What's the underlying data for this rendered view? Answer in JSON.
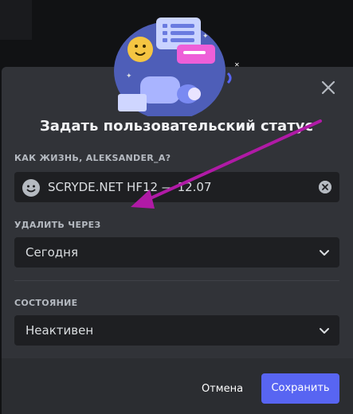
{
  "dialog": {
    "title": "Задать пользовательский статус",
    "status_label": "КАК ЖИЗНЬ, ALEKSANDER_A?",
    "status_value": "SCRYDE.NET HF12 — 12.07",
    "clear_after_label": "УДАЛИТЬ ЧЕРЕЗ",
    "clear_after_value": "Сегодня",
    "state_label": "СОСТОЯНИЕ",
    "state_value": "Неактивен",
    "cancel_label": "Отмена",
    "save_label": "Сохранить"
  },
  "icons": {
    "close": "close-icon",
    "emoji": "smiley-emoji-icon",
    "clear": "clear-circle-icon",
    "dropdown": "chevron-down-icon",
    "annotation": "magenta-arrow-annotation"
  },
  "colors": {
    "modal_bg": "#313338",
    "field_bg": "#1e1f22",
    "accent": "#5865f2",
    "annotation_arrow": "#b01aa6"
  }
}
